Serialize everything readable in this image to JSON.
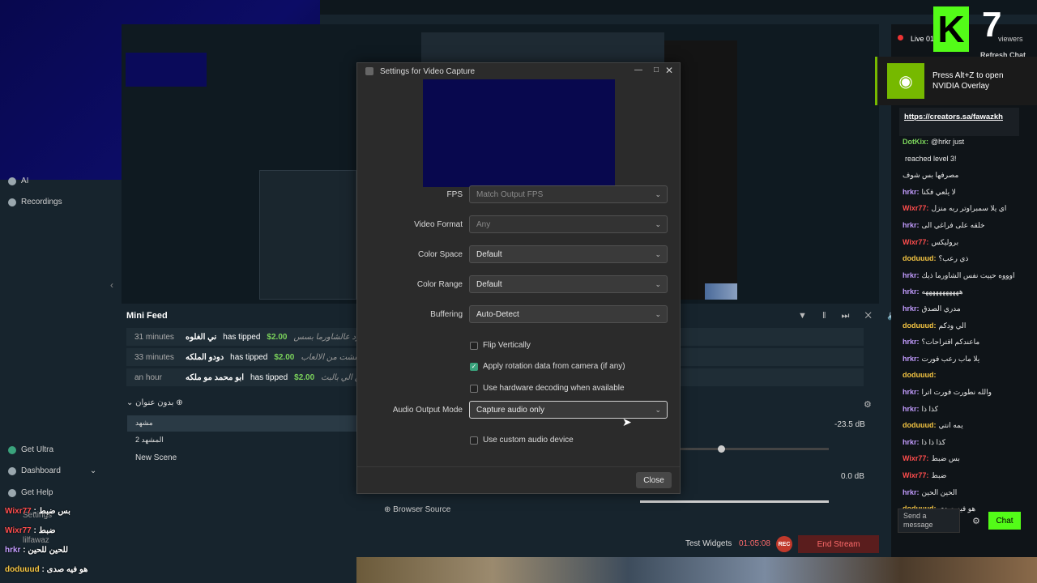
{
  "left_nav": {
    "items": [
      {
        "label": "AI"
      },
      {
        "label": "Recordings"
      }
    ],
    "bottom_items": [
      {
        "label": "Get Ultra"
      },
      {
        "label": "Dashboard"
      },
      {
        "label": "Get Help"
      },
      {
        "label": "Settings"
      },
      {
        "label": "lilfawaz"
      }
    ]
  },
  "mini_feed": {
    "title": "Mini Feed",
    "rows": [
      {
        "time": "31 minutes",
        "name": "ني الغلوه",
        "action": "has tipped",
        "amount": "$2.00",
        "message": "يلا رد عالشاورما بسس"
      },
      {
        "time": "33 minutes",
        "name": "دودو الملكه",
        "action": "has tipped",
        "amount": "$2.00",
        "message": "طفشت من الالعاب"
      },
      {
        "time": "an hour",
        "name": "ابو محمد مو ملكه",
        "action": "has tipped",
        "amount": "$2.00",
        "message": "صدقه عني وعن الي بالبث"
      }
    ]
  },
  "scenes": {
    "title": "بدون عنوان",
    "items": [
      "مشهد",
      "المشهد 2",
      "New Scene"
    ]
  },
  "sources": {
    "browser_source": "Browser Source"
  },
  "audio": {
    "level1": "-23.5 dB",
    "level2": "0.0 dB"
  },
  "status_bar": {
    "test_widgets": "Test Widgets",
    "timer": "01:05:08",
    "rec": "REC",
    "end_stream": "End Stream"
  },
  "chat": {
    "live": "Live 01",
    "viewers": "viewers",
    "refresh": "Refresh Chat",
    "nvidia_text": "Press Alt+Z to open NVIDIA Overlay",
    "link": "https://creators.sa/fawazkh",
    "send_placeholder": "Send a message",
    "chat_button": "Chat",
    "messages": [
      {
        "user": "DotKix:",
        "text": "@hrkr just",
        "color": "#7bd35b"
      },
      {
        "user": "",
        "text": "reached level 3!",
        "color": "#ffffff"
      },
      {
        "user": "",
        "text": "مصرفها بس شوف",
        "color": "#ffffff"
      },
      {
        "user": "hrkr:",
        "text": "لا يلعي فكنا",
        "color": "#c39cff"
      },
      {
        "user": "Wixr77:",
        "text": "اي يلا سمبراوتر ربه منزل",
        "color": "#ff4d4d"
      },
      {
        "user": "hrkr:",
        "text": "خلقه على فراغي الى",
        "color": "#c39cff"
      },
      {
        "user": "Wixr77:",
        "text": "بروليكس",
        "color": "#ff4d4d"
      },
      {
        "user": "doduuud:",
        "text": "ذي رعب؟",
        "color": "#f5c542"
      },
      {
        "user": "hrkr:",
        "text": "اوووه حييت نفس الشاورما ذيك",
        "color": "#c39cff"
      },
      {
        "user": "hrkr:",
        "text": "هههههههههههه",
        "color": "#c39cff"
      },
      {
        "user": "hrkr:",
        "text": "مدري الصدق",
        "color": "#c39cff"
      },
      {
        "user": "doduuud:",
        "text": "الي ودكم",
        "color": "#f5c542"
      },
      {
        "user": "hrkr:",
        "text": "ماعندكم اقتراحات؟",
        "color": "#c39cff"
      },
      {
        "user": "hrkr:",
        "text": "يلا ماب رعب فورت",
        "color": "#c39cff"
      },
      {
        "user": "doduuud:",
        "text": "",
        "color": "#f5c542"
      },
      {
        "user": "hrkr:",
        "text": "والله نطورت فورت اترا",
        "color": "#c39cff"
      },
      {
        "user": "hrkr:",
        "text": "كذا ذا",
        "color": "#c39cff"
      },
      {
        "user": "doduuud:",
        "text": "يمه انتي",
        "color": "#f5c542"
      },
      {
        "user": "hrkr:",
        "text": "كذا ذا ذا",
        "color": "#c39cff"
      },
      {
        "user": "Wixr77:",
        "text": "بس ضبط",
        "color": "#ff4d4d"
      },
      {
        "user": "Wixr77:",
        "text": "ضبط",
        "color": "#ff4d4d"
      },
      {
        "user": "hrkr:",
        "text": "الحين الحين",
        "color": "#c39cff"
      },
      {
        "user": "doduuud:",
        "text": "هو فيه صدى",
        "color": "#f5c542"
      }
    ]
  },
  "overlay_chat": [
    {
      "user": "Wixr77",
      "text": "بس ضبط",
      "color": "#ff4d4d"
    },
    {
      "user": "Wixr77",
      "text": "ضبط",
      "color": "#ff4d4d"
    },
    {
      "user": "hrkr",
      "text": "للحين للحين",
      "color": "#c39cff"
    },
    {
      "user": "doduuud",
      "text": "هو فيه صدى",
      "color": "#f5c542"
    }
  ],
  "dialog": {
    "title": "Settings for Video Capture",
    "fps_label": "FPS",
    "fps_value": "Match Output FPS",
    "video_format_label": "Video Format",
    "video_format_value": "Any",
    "color_space_label": "Color Space",
    "color_space_value": "Default",
    "color_range_label": "Color Range",
    "color_range_value": "Default",
    "buffering_label": "Buffering",
    "buffering_value": "Auto-Detect",
    "flip_label": "Flip Vertically",
    "flip_checked": false,
    "rotation_label": "Apply rotation data from camera (if any)",
    "rotation_checked": true,
    "hwdecode_label": "Use hardware decoding when available",
    "hwdecode_checked": false,
    "audio_mode_label": "Audio Output Mode",
    "audio_mode_value": "Capture audio only",
    "custom_audio_label": "Use custom audio device",
    "custom_audio_checked": false,
    "close_label": "Close"
  },
  "logo": {
    "letter": "K",
    "number": "7"
  }
}
